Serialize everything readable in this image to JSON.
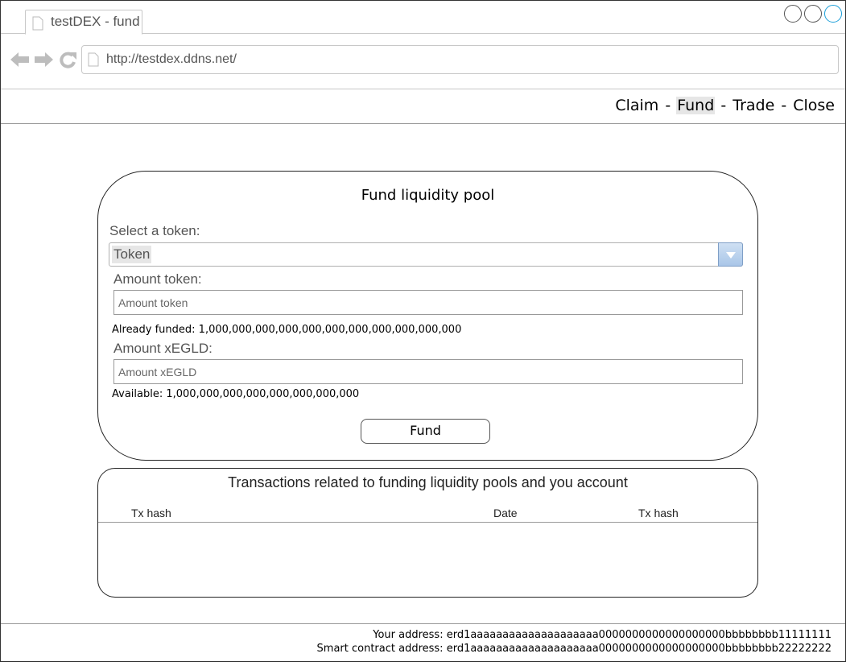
{
  "browser": {
    "tab_title": "testDEX - fund",
    "url": "http://testdex.ddns.net/",
    "window_controls": [
      "minimize-icon",
      "maximize-icon",
      "close-icon"
    ],
    "nav_icons": [
      "back-arrow-icon",
      "forward-arrow-icon",
      "refresh-icon"
    ]
  },
  "menu": {
    "items": [
      "Claim",
      "Fund",
      "Trade",
      "Close"
    ],
    "separator": "-",
    "active": "Fund"
  },
  "fund_form": {
    "title": "Fund liquidity pool",
    "token_label": "Select a token:",
    "token_selected": "Token",
    "amount_token_label": "Amount token:",
    "amount_token_placeholder": "Amount token",
    "already_funded": "Already funded: 1,000,000,000,000,000,000,000,000,000,000,000",
    "amount_xegld_label": "Amount xEGLD:",
    "amount_xegld_placeholder": "Amount xEGLD",
    "available": "Available: 1,000,000,000,000,000,000,000,000",
    "fund_button": "Fund"
  },
  "transactions": {
    "title": "Transactions related to funding liquidity pools and you account",
    "columns": [
      "Tx hash",
      "Date",
      "Tx hash"
    ],
    "rows": []
  },
  "footer": {
    "your_address": "Your address: erd1aaaaaaaaaaaaaaaaaaaa0000000000000000000bbbbbbbb11111111",
    "contract_address": "Smart contract address: erd1aaaaaaaaaaaaaaaaaaaa0000000000000000000bbbbbbbb22222222"
  },
  "colors": {
    "accent_blue": "#1a9ed8",
    "select_arrow": "#a9c6e8",
    "active_menu_bg": "#e6e6e6"
  }
}
